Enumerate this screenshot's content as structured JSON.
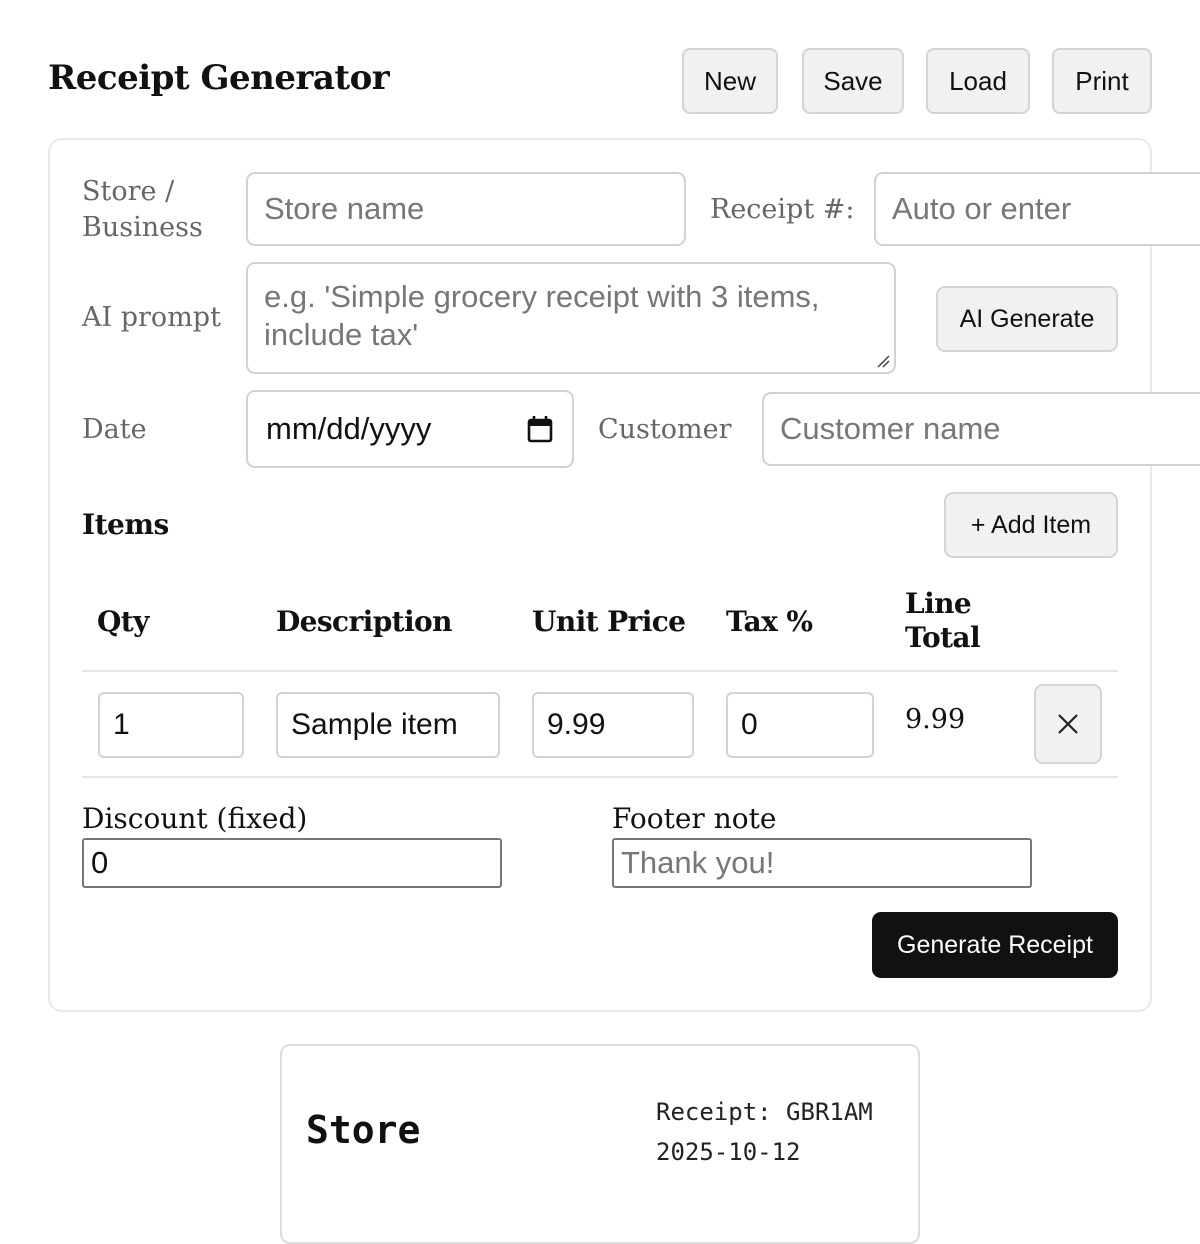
{
  "app": {
    "title": "Receipt Generator"
  },
  "toolbar": {
    "new_label": "New",
    "save_label": "Save",
    "load_label": "Load",
    "print_label": "Print"
  },
  "form": {
    "store": {
      "label_line1": "Store /",
      "label_line2": "Business",
      "placeholder": "Store name",
      "value": ""
    },
    "receipt_number": {
      "label": "Receipt #:",
      "placeholder": "Auto or enter",
      "value": ""
    },
    "ai_prompt": {
      "label": "AI prompt",
      "placeholder": "e.g. 'Simple grocery receipt with 3 items, include tax'",
      "value": "",
      "button_label": "AI Generate"
    },
    "date": {
      "label": "Date",
      "placeholder": "mm/dd/yyyy",
      "icon": "calendar-icon"
    },
    "customer": {
      "label": "Customer",
      "placeholder": "Customer name",
      "value": ""
    }
  },
  "items": {
    "title": "Items",
    "add_button_label": "+ Add Item",
    "columns": {
      "qty": "Qty",
      "description": "Description",
      "unit_price": "Unit Price",
      "tax": "Tax %",
      "line_total_line1": "Line",
      "line_total_line2": "Total"
    },
    "rows": [
      {
        "qty": "1",
        "description": "Sample item",
        "unit_price": "9.99",
        "tax": "0",
        "line_total": "9.99",
        "remove_icon": "close-icon"
      }
    ]
  },
  "discount": {
    "label": "Discount (fixed)",
    "value": "0"
  },
  "footer_note": {
    "label": "Footer note",
    "placeholder": "Thank you!",
    "value": ""
  },
  "actions": {
    "generate_label": "Generate Receipt"
  },
  "preview": {
    "store": "Store",
    "receipt_line": "Receipt: GBR1AM",
    "date": "2025-10-12"
  },
  "colors": {
    "primary_button": "#111111",
    "button_background": "#f1f1f1",
    "border": "#d2d2d2",
    "muted_label": "#666666"
  }
}
